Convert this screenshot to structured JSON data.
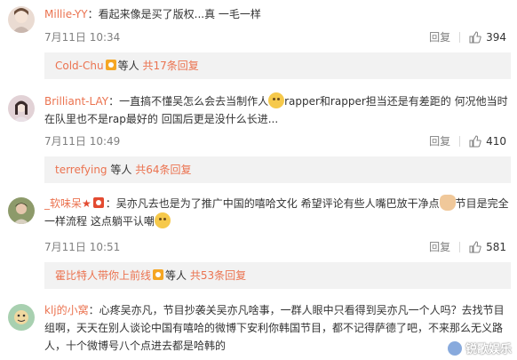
{
  "comments": [
    {
      "user": "Millie-YY",
      "text": "：看起来像是买了版权...真 一毛一样",
      "time": "7月11日 10:34",
      "reply_label": "回复",
      "likes": "394",
      "replies_box": {
        "user": "Cold-Chu",
        "suffix": "等人",
        "link": "共17条回复"
      },
      "avatar_color": "#e8d8d0"
    },
    {
      "user": "Brilliant-LAY",
      "text_a": "：一直搞不懂吴怎么会去当制作人",
      "text_b": "rapper和rapper担当还是有差距的 何况他当时在队里也不是rap最好的 回国后更是没什么长进...",
      "time": "7月11日 10:49",
      "reply_label": "回复",
      "likes": "410",
      "replies_box": {
        "user": "terrefying",
        "suffix": "等人",
        "link": "共64条回复"
      },
      "avatar_color": "#d7c2c8"
    },
    {
      "user": "_软味呆",
      "text_a": "：吴亦凡去也是为了推广中国的嘻哈文化 希望评论有些人嘴巴放干净点",
      "text_b": "节目是完全一样流程 这点躺平认嘲",
      "time": "7月11日 10:51",
      "reply_label": "回复",
      "likes": "581",
      "replies_box": {
        "user": "霍比特人带你上前线",
        "suffix": "等人",
        "link": "共53条回复"
      },
      "avatar_color": "#7a8a5a"
    },
    {
      "user": "klj的小窝",
      "text": "：心疼吴亦凡，节目抄袭关吴亦凡啥事，一群人眼中只看得到吴亦凡一个人吗？去找节目组啊，天天在别人谈论中国有嘻哈的微博下安利你韩国节目，都不记得萨德了吧，不来那么无义路人，十个微博号八个点进去都是哈韩的",
      "avatar_color": "#9ac8a0"
    }
  ],
  "watermark": "锐歌娱乐",
  "colors": {
    "username": "#eb7350",
    "meta": "#808080",
    "reply_bg": "#f2f2f2"
  }
}
